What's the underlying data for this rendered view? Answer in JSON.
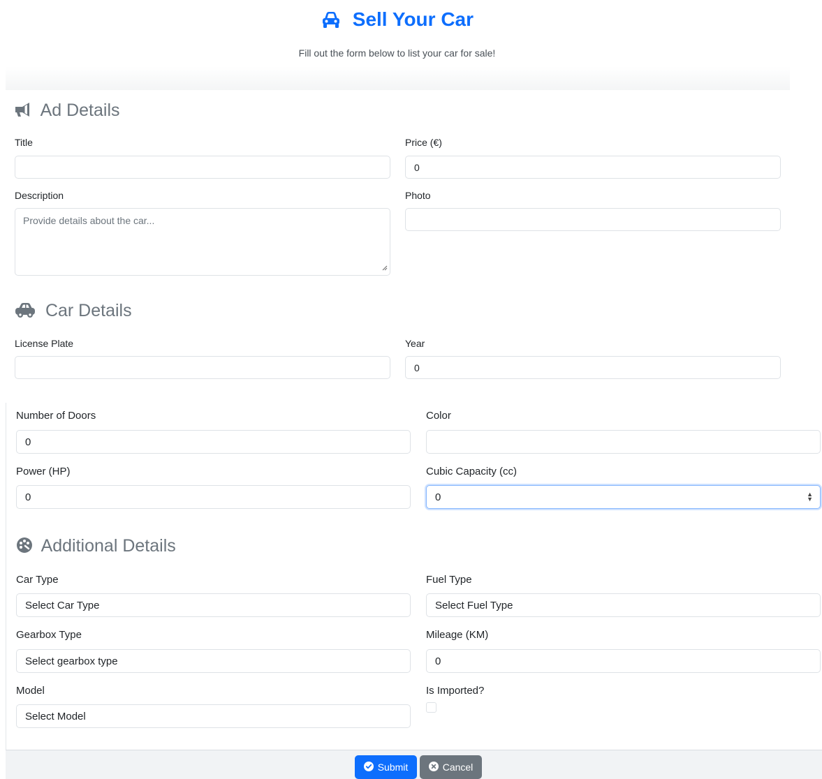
{
  "header": {
    "title": "Sell Your Car",
    "subtitle": "Fill out the form below to list your car for sale!"
  },
  "ad_details": {
    "title": "Ad Details",
    "title_label": "Title",
    "title_value": "",
    "price_label": "Price (€)",
    "price_value": "0",
    "description_label": "Description",
    "description_placeholder": "Provide details about the car...",
    "photo_label": "Photo",
    "photo_value": ""
  },
  "car_details": {
    "title": "Car Details",
    "license_plate_label": "License Plate",
    "license_plate_value": "",
    "year_label": "Year",
    "year_value": "0",
    "doors_label": "Number of Doors",
    "doors_value": "0",
    "color_label": "Color",
    "color_value": "",
    "power_label": "Power (HP)",
    "power_value": "0",
    "cc_label": "Cubic Capacity (cc)",
    "cc_value": "0"
  },
  "additional_details": {
    "title": "Additional Details",
    "car_type_label": "Car Type",
    "car_type_value": "Select Car Type",
    "fuel_type_label": "Fuel Type",
    "fuel_type_value": "Select Fuel Type",
    "gearbox_label": "Gearbox Type",
    "gearbox_value": "Select gearbox type",
    "mileage_label": "Mileage (KM)",
    "mileage_value": "0",
    "model_label": "Model",
    "model_value": "Select Model",
    "imported_label": "Is Imported?",
    "imported_checked": false
  },
  "actions": {
    "submit_label": "Submit",
    "cancel_label": "Cancel"
  },
  "colors": {
    "primary": "#0d6efd",
    "secondary": "#6c757d",
    "section_heading": "#6c757d"
  },
  "icons": {
    "title": "car-icon",
    "ad_section": "megaphone-icon",
    "car_section": "car-icon",
    "additional_section": "palette-icon",
    "submit": "check-circle-icon",
    "cancel": "x-circle-icon"
  }
}
